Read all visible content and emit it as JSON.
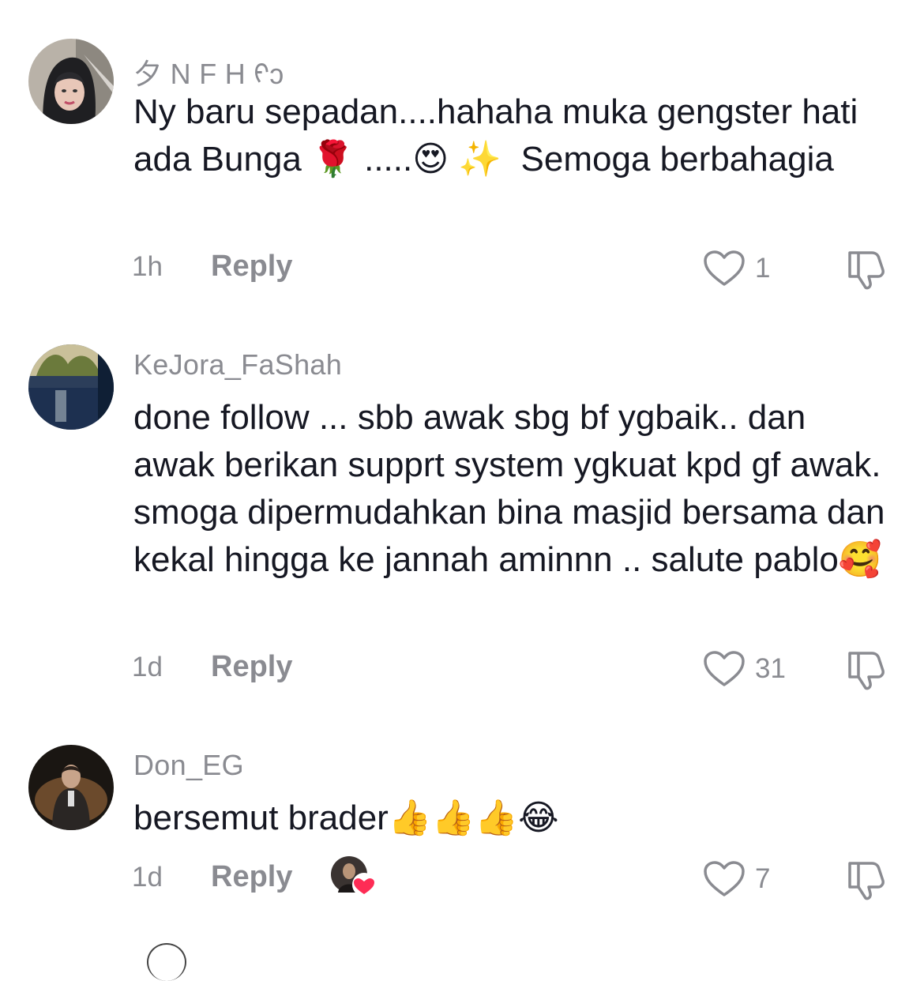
{
  "comments": [
    {
      "username": "⼣ N F H ᠻɔ",
      "text": "Ny baru sepadan....hahaha muka gengster hati ada Bunga 🌹 .....😍 ✨  Semoga berbahagia",
      "time": "1h",
      "reply_label": "Reply",
      "like_count": "1",
      "avatar_icon": "avatar-hijab-woman"
    },
    {
      "username": "KeJora_FaShah",
      "text": "done follow ... sbb awak sbg bf ygbaik.. dan awak berikan supprt system ygkuat kpd gf awak. smoga dipermudahkan bina masjid bersama dan kekal hingga ke jannah aminnn .. salute pablo🥰",
      "time": "1d",
      "reply_label": "Reply",
      "like_count": "31",
      "avatar_icon": "avatar-scenery"
    },
    {
      "username": "Don_EG",
      "text": "bersemut brader👍👍👍😂",
      "time": "1d",
      "reply_label": "Reply",
      "like_count": "7",
      "avatar_icon": "avatar-man-in-chair",
      "creator_liked": true
    }
  ],
  "icons": {
    "like": "heart-outline-icon",
    "dislike": "thumbs-down-outline-icon",
    "creator_like": "creator-liked-heart-icon"
  },
  "colors": {
    "text": "#161823",
    "muted": "#8a8b91",
    "heart_red": "#fe2c55"
  }
}
